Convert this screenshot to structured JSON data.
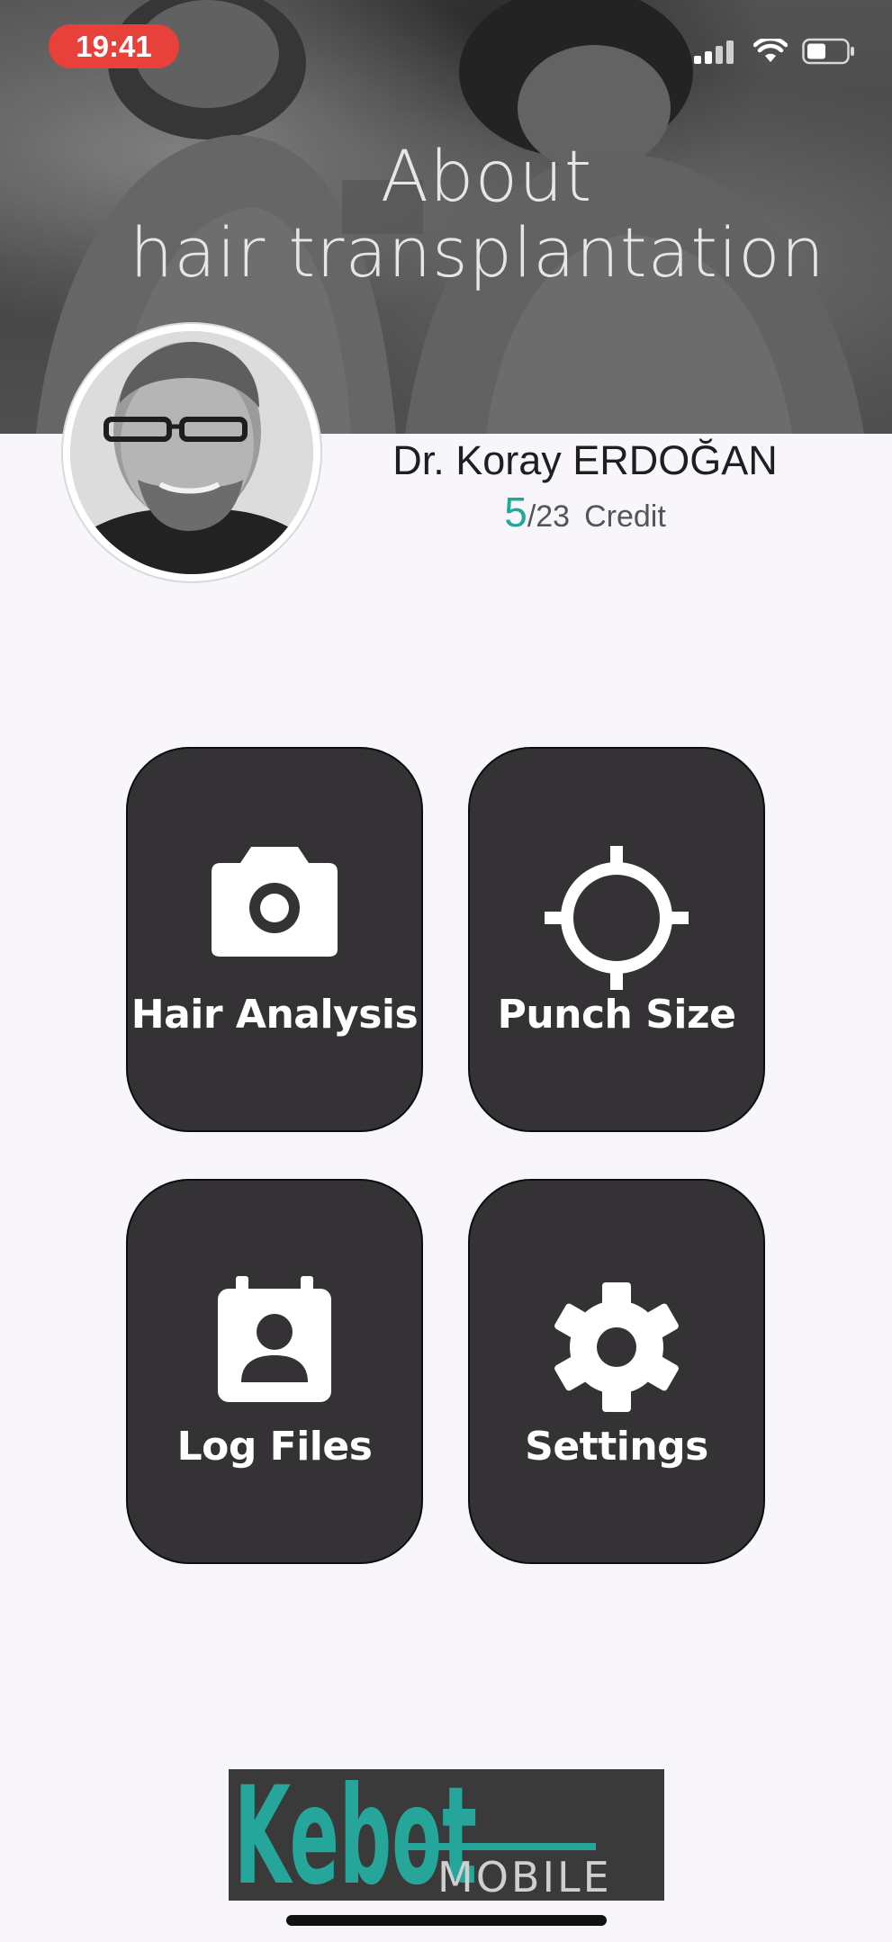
{
  "status_bar": {
    "time": "19:41"
  },
  "banner": {
    "title_line1": "About",
    "title_line2": "hair transplantation"
  },
  "profile": {
    "name": "Dr. Koray ERDOĞAN",
    "credits_used": "5",
    "credits_total": "/23",
    "credits_label": "Credit"
  },
  "menu": {
    "tiles": [
      {
        "label": "Hair Analysis",
        "icon": "camera-icon"
      },
      {
        "label": "Punch Size",
        "icon": "crosshair-icon"
      },
      {
        "label": "Log Files",
        "icon": "contact-calendar-icon"
      },
      {
        "label": "Settings",
        "icon": "gear-icon"
      }
    ]
  },
  "logo": {
    "brand_main": "Kebot",
    "brand_sub": "MOBILE"
  },
  "colors": {
    "accent": "#26a69a",
    "tile_bg": "#343235",
    "status_time_bg": "#e8413c",
    "page_bg": "#f8f6fa"
  }
}
